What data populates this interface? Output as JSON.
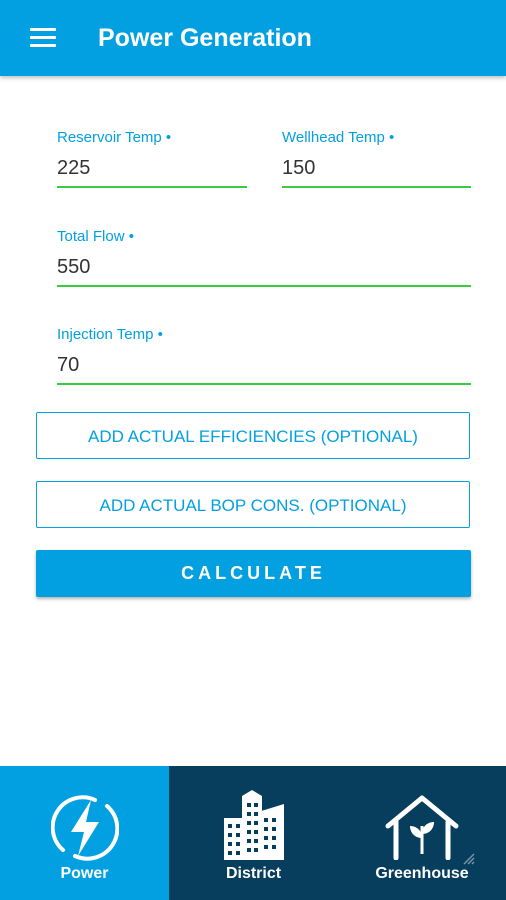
{
  "header": {
    "title": "Power Generation",
    "menu_icon": "hamburger-menu-icon"
  },
  "form": {
    "reservoir_temp": {
      "label": "Reservoir Temp •",
      "value": "225"
    },
    "wellhead_temp": {
      "label": "Wellhead Temp •",
      "value": "150"
    },
    "total_flow": {
      "label": "Total Flow •",
      "value": "550"
    },
    "injection_temp": {
      "label": "Injection Temp •",
      "value": "70"
    }
  },
  "buttons": {
    "add_efficiencies": "ADD ACTUAL EFFICIENCIES (OPTIONAL)",
    "add_bop": "ADD ACTUAL BOP CONS. (OPTIONAL)",
    "calculate": "CALCULATE"
  },
  "bottom_nav": {
    "items": [
      {
        "label": "Power",
        "icon": "lightning-bolt-icon",
        "active": true
      },
      {
        "label": "District",
        "icon": "city-buildings-icon",
        "active": false
      },
      {
        "label": "Greenhouse",
        "icon": "greenhouse-plant-icon",
        "active": false
      }
    ]
  },
  "colors": {
    "primary": "#03A0E1",
    "nav_background": "#073E5E",
    "field_underline": "#3CCB3C"
  }
}
